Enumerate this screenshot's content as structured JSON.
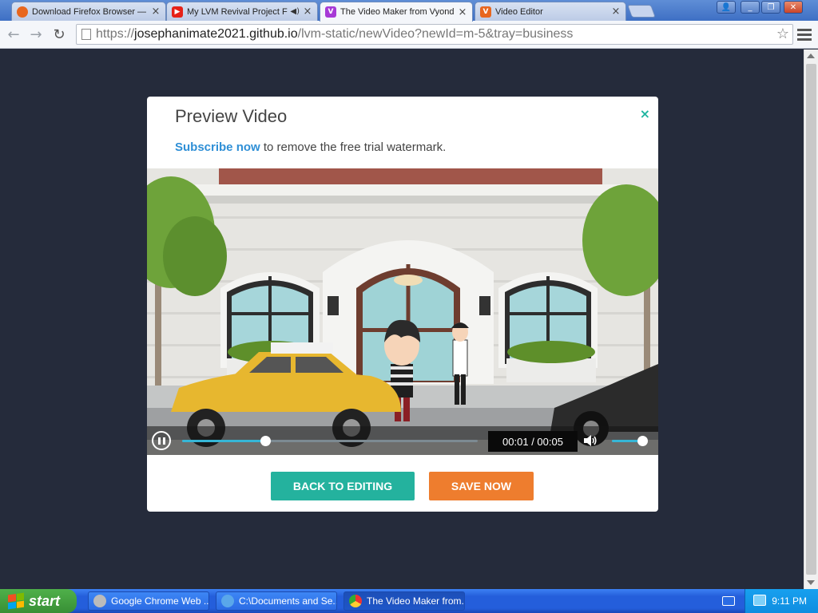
{
  "browser": {
    "tabs": [
      {
        "title": "Download Firefox Browser —",
        "icon": "firefox-icon",
        "color": "#e8661e"
      },
      {
        "title": "My LVM Revival Project Fo",
        "icon": "youtube-icon",
        "color": "#e62117",
        "audio": true
      },
      {
        "title": "The Video Maker from Vyond",
        "icon": "vyond-icon",
        "color": "#a73ad6",
        "active": true
      },
      {
        "title": "Video Editor",
        "icon": "video-editor-icon",
        "color": "#e8661e",
        "glyph": "V"
      }
    ],
    "url": {
      "scheme": "https://",
      "host": "josephanimate2021.github.io",
      "path": "/lvm-static/newVideo?newId=m-5&tray=business"
    }
  },
  "modal": {
    "title": "Preview Video",
    "close_glyph": "×",
    "subscribe_link": "Subscribe now",
    "subscribe_rest": " to remove the free trial watermark.",
    "player": {
      "time_current": "00:01",
      "time_total": "00:05",
      "time_display": "00:01 / 00:05",
      "progress": 0.28,
      "volume": 0.9,
      "state": "playing"
    },
    "back_button": "BACK TO EDITING",
    "save_button": "SAVE NOW"
  },
  "taskbar": {
    "start_label": "start",
    "tasks": [
      {
        "label": "Google Chrome Web ..."
      },
      {
        "label": "C:\\Documents and Se..."
      },
      {
        "label": "The Video Maker from...",
        "active": true
      }
    ],
    "clock": "9:11 PM"
  }
}
